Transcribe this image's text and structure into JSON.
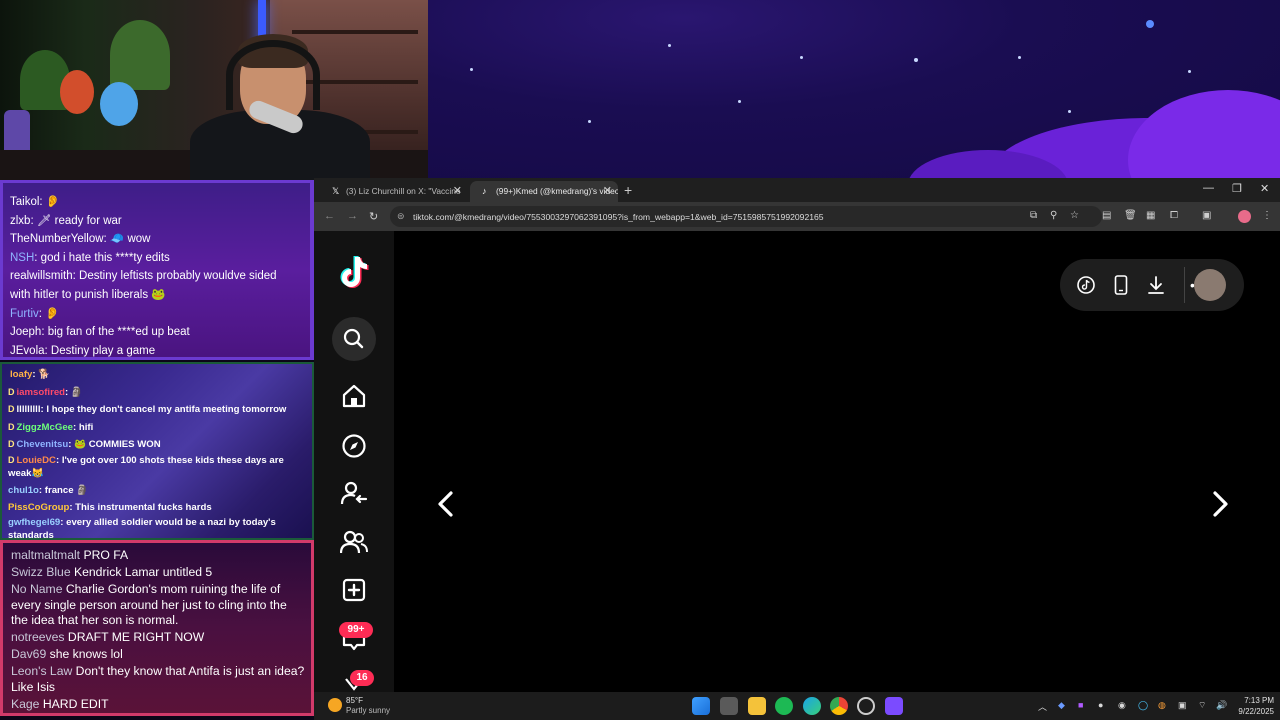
{
  "chat1": {
    "messages": [
      {
        "user": "Taikol",
        "text": ": 👂",
        "user_color": "white"
      },
      {
        "user": "zlxb",
        "text": ":  🗡  ready for war",
        "user_color": "white"
      },
      {
        "user": "TheNumberYellow",
        "text": ": 🧢 wow",
        "user_color": "white"
      },
      {
        "user": "NSH",
        "text": ": god i hate this ****ty edits",
        "user_color": "blue"
      },
      {
        "user": "realwillsmith",
        "text": ": Destiny leftists probably wouldve sided",
        "user_color": "white"
      },
      {
        "user": "",
        "text": "with hitler to punish liberals 🐸",
        "user_color": "white"
      },
      {
        "user": "Furtiv",
        "text": ": 👂",
        "user_color": "blue"
      },
      {
        "user": "Joeph",
        "text": ": big fan of the ****ed up beat",
        "user_color": "white"
      },
      {
        "user": "JEvola",
        "text": ": Destiny play a game",
        "user_color": "white"
      }
    ]
  },
  "chat2": {
    "messages": [
      {
        "badge": "",
        "user": "loafy",
        "text": ": 🐕",
        "user_color": "#ffb347"
      },
      {
        "badge": "D",
        "user": "iamsofired",
        "text": ": 🗿",
        "user_color": "#ff4a6a"
      },
      {
        "badge": "D",
        "user": "lllllllll",
        "text": ": I hope they don't cancel my antifa meeting tomorrow",
        "user_color": "#ffffff"
      },
      {
        "badge": "D",
        "user": "ZiggzMcGee",
        "text": ": hifi",
        "user_color": "#6dff7a"
      },
      {
        "badge": "D",
        "user": "Chevenitsu",
        "text": ": 🐸 COMMIES WON",
        "user_color": "#8fb4ff"
      },
      {
        "badge": "D",
        "user": "LouieDC",
        "text": ": I've got over 100 shots these kids these days are weak😹",
        "user_color": "#ff8a4a"
      },
      {
        "badge": "",
        "user": "chul1o",
        "text": ": france 🗿",
        "user_color": "#9ad0ff"
      },
      {
        "badge": "",
        "user": "PissCoGroup",
        "text": ": This instrumental fucks hards",
        "user_color": "#ffc83a"
      },
      {
        "badge": "",
        "user": "gwfhegel69",
        "text": ": every allied soldier would be a nazi by today's standards",
        "user_color": "#9ad0ff"
      }
    ]
  },
  "chat3": {
    "messages": [
      {
        "user": "maltmaltmalt",
        "text": "PRO FA"
      },
      {
        "user": "Swizz Blue",
        "text": "Kendrick Lamar untitled 5"
      },
      {
        "user": "No Name",
        "text": "Charlie Gordon's mom ruining the life of every single person around her just to cling into the the idea that her son is normal."
      },
      {
        "user": "notreeves",
        "text": "DRAFT ME RIGHT NOW"
      },
      {
        "user": "Dav69",
        "text": "she knows lol"
      },
      {
        "user": "Leon's Law",
        "text": "Don't they know that Antifa is just an idea? Like Isis"
      },
      {
        "user": "Kage",
        "text": "HARD EDIT"
      }
    ]
  },
  "browser": {
    "tabs": [
      {
        "icon": "x-icon",
        "title": "(3) Liz Churchill on X: \"Vaccine"
      },
      {
        "icon": "tiktok-icon",
        "title": "(99+)Kmed (@kmedrang)'s video"
      }
    ],
    "url": "tiktok.com/@kmedrang/video/7553003297062391095?is_from_webapp=1&web_id=7515985751992092165"
  },
  "tiktok": {
    "inbox_badge": "99+",
    "profile_badge": "16"
  },
  "taskbar": {
    "temperature": "85°F",
    "condition": "Partly sunny",
    "time": "7:13 PM",
    "date": "9/22/2025"
  },
  "colors": {
    "tiktok_red": "#fe2c55",
    "tiktok_cyan": "#25f4ee",
    "chat1_border": "#6b3ad0",
    "chat3_border": "#d23a6a"
  }
}
